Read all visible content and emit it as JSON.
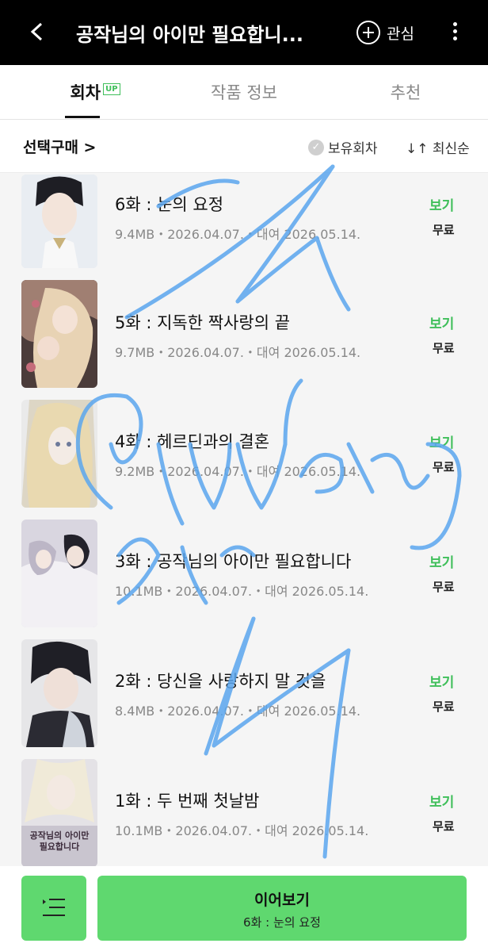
{
  "header": {
    "title": "공작님의 아이만 필요합니...",
    "favorite_label": "관심",
    "icons": [
      "back-arrow-icon",
      "plus-circle-icon",
      "more-vertical-icon"
    ]
  },
  "tabs": [
    {
      "label": "회차",
      "badge": "UP",
      "active": true
    },
    {
      "label": "작품 정보",
      "active": false
    },
    {
      "label": "추천",
      "active": false
    }
  ],
  "filter": {
    "select_purchase": "선택구매 >",
    "owned_label": "보유회차",
    "sort_label": "↓↑ 최신순"
  },
  "episodes": [
    {
      "title": "6화 : 눈의 요정",
      "meta": "9.4MB・2026.04.07.・대여 2026.05.14.",
      "action": "보기",
      "price": "무료"
    },
    {
      "title": "5화 : 지독한 짝사랑의 끝",
      "meta": "9.7MB・2026.04.07.・대여 2026.05.14.",
      "action": "보기",
      "price": "무료"
    },
    {
      "title": "4화 : 헤르딘과의 결혼",
      "meta": "9.2MB・2026.04.07.・대여 2026.05.14.",
      "action": "보기",
      "price": "무료"
    },
    {
      "title": "3화 : 공작님의 아이만 필요합니다",
      "meta": "10.1MB・2026.04.07.・대여 2026.05.14.",
      "action": "보기",
      "price": "무료"
    },
    {
      "title": "2화 : 당신을 사랑하지 말 것을",
      "meta": "8.4MB・2026.04.07.・대여 2026.05.14.",
      "action": "보기",
      "price": "무료"
    },
    {
      "title": "1화 : 두 번째 첫날밤",
      "meta": "10.1MB・2026.04.07.・대여 2026.05.14.",
      "action": "보기",
      "price": "무료",
      "cover_text": "공작님의 아이만 필요합니다"
    }
  ],
  "bottom": {
    "continue_label": "이어보기",
    "continue_sub": "6화 : 눈의 요정"
  },
  "watermark": {
    "text": "@hubang 3rr"
  },
  "colors": {
    "accent": "#5fd86f",
    "accent_text": "#3fbf5a",
    "header_bg": "#000000",
    "watermark": "#5aa6ee"
  }
}
